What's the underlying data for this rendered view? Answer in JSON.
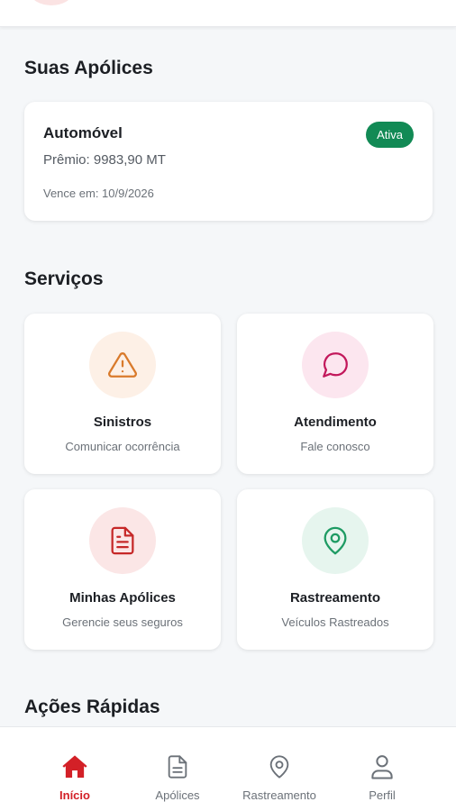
{
  "policies_section": {
    "title": "Suas Apólices",
    "card": {
      "type": "Automóvel",
      "premium": "Prêmio: 9983,90 MT",
      "expiry": "Vence em: 10/9/2026",
      "status": "Ativa"
    }
  },
  "services_section": {
    "title": "Serviços",
    "items": [
      {
        "title": "Sinistros",
        "subtitle": "Comunicar ocorrência",
        "icon": "warning-triangle-icon"
      },
      {
        "title": "Atendimento",
        "subtitle": "Fale conosco",
        "icon": "chat-bubble-icon"
      },
      {
        "title": "Minhas Apólices",
        "subtitle": "Gerencie seus seguros",
        "icon": "document-icon"
      },
      {
        "title": "Rastreamento",
        "subtitle": "Veículos Rastreados",
        "icon": "map-pin-icon"
      }
    ]
  },
  "quick_actions_section": {
    "title": "Ações Rápidas"
  },
  "bottom_nav": {
    "items": [
      {
        "label": "Início",
        "icon": "home-icon",
        "active": true
      },
      {
        "label": "Apólices",
        "icon": "document-icon",
        "active": false
      },
      {
        "label": "Rastreamento",
        "icon": "map-pin-icon",
        "active": false
      },
      {
        "label": "Perfil",
        "icon": "user-icon",
        "active": false
      }
    ]
  },
  "colors": {
    "brand_red": "#d32027",
    "status_green": "#128a55",
    "warning_orange": "#d97a2b",
    "chat_pink": "#c2185b",
    "doc_red": "#c62828",
    "pin_green": "#1e9b63"
  }
}
